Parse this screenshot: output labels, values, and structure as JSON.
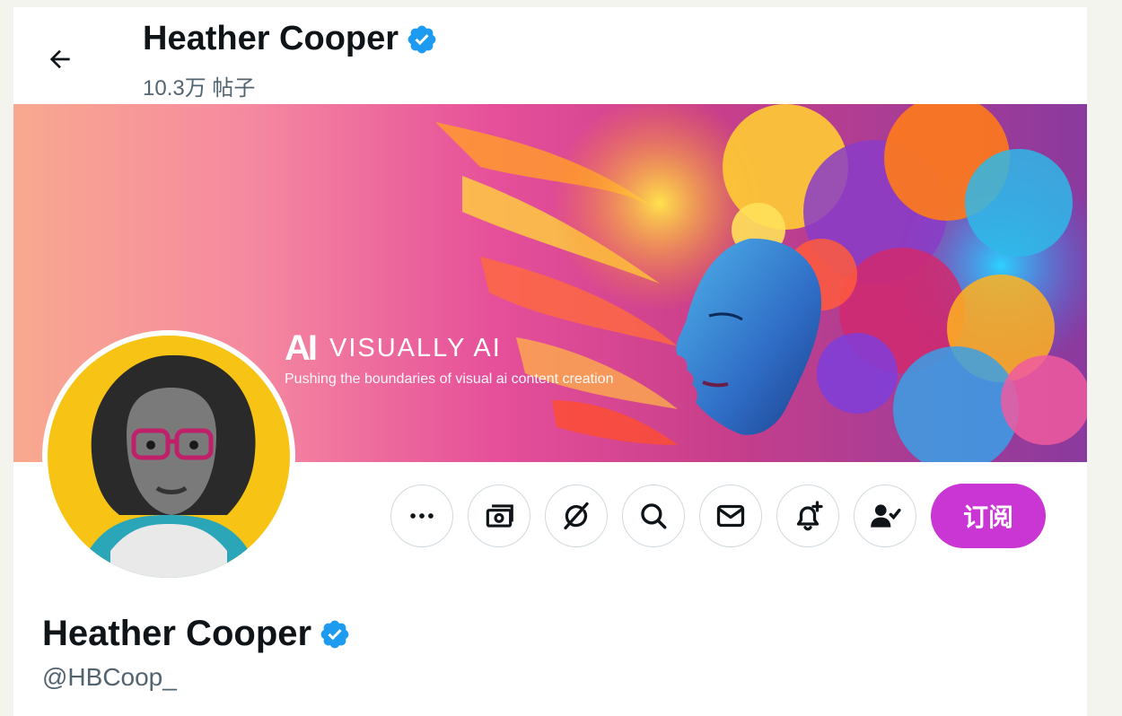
{
  "header": {
    "back_icon": "arrow-left-icon",
    "name": "Heather Cooper",
    "posts_count": "10.3万 帖子",
    "verified_icon": "verified-badge-icon"
  },
  "banner": {
    "brand_mark": "AI",
    "brand_name": "VISUALLY AI",
    "tagline": "Pushing the boundaries of visual ai content creation"
  },
  "actions": {
    "buttons": [
      "more-icon",
      "tip-money-icon",
      "grok-icon",
      "search-icon",
      "message-icon",
      "notification-add-icon",
      "following-icon"
    ],
    "subscribe_label": "订阅"
  },
  "profile": {
    "display_name": "Heather Cooper",
    "handle": "@HBCoop_"
  },
  "colors": {
    "accent_subscribe": "#c936d4",
    "verified": "#1d9bf0",
    "text_primary": "#0f1419",
    "text_secondary": "#536471",
    "border": "#cfd9de"
  }
}
